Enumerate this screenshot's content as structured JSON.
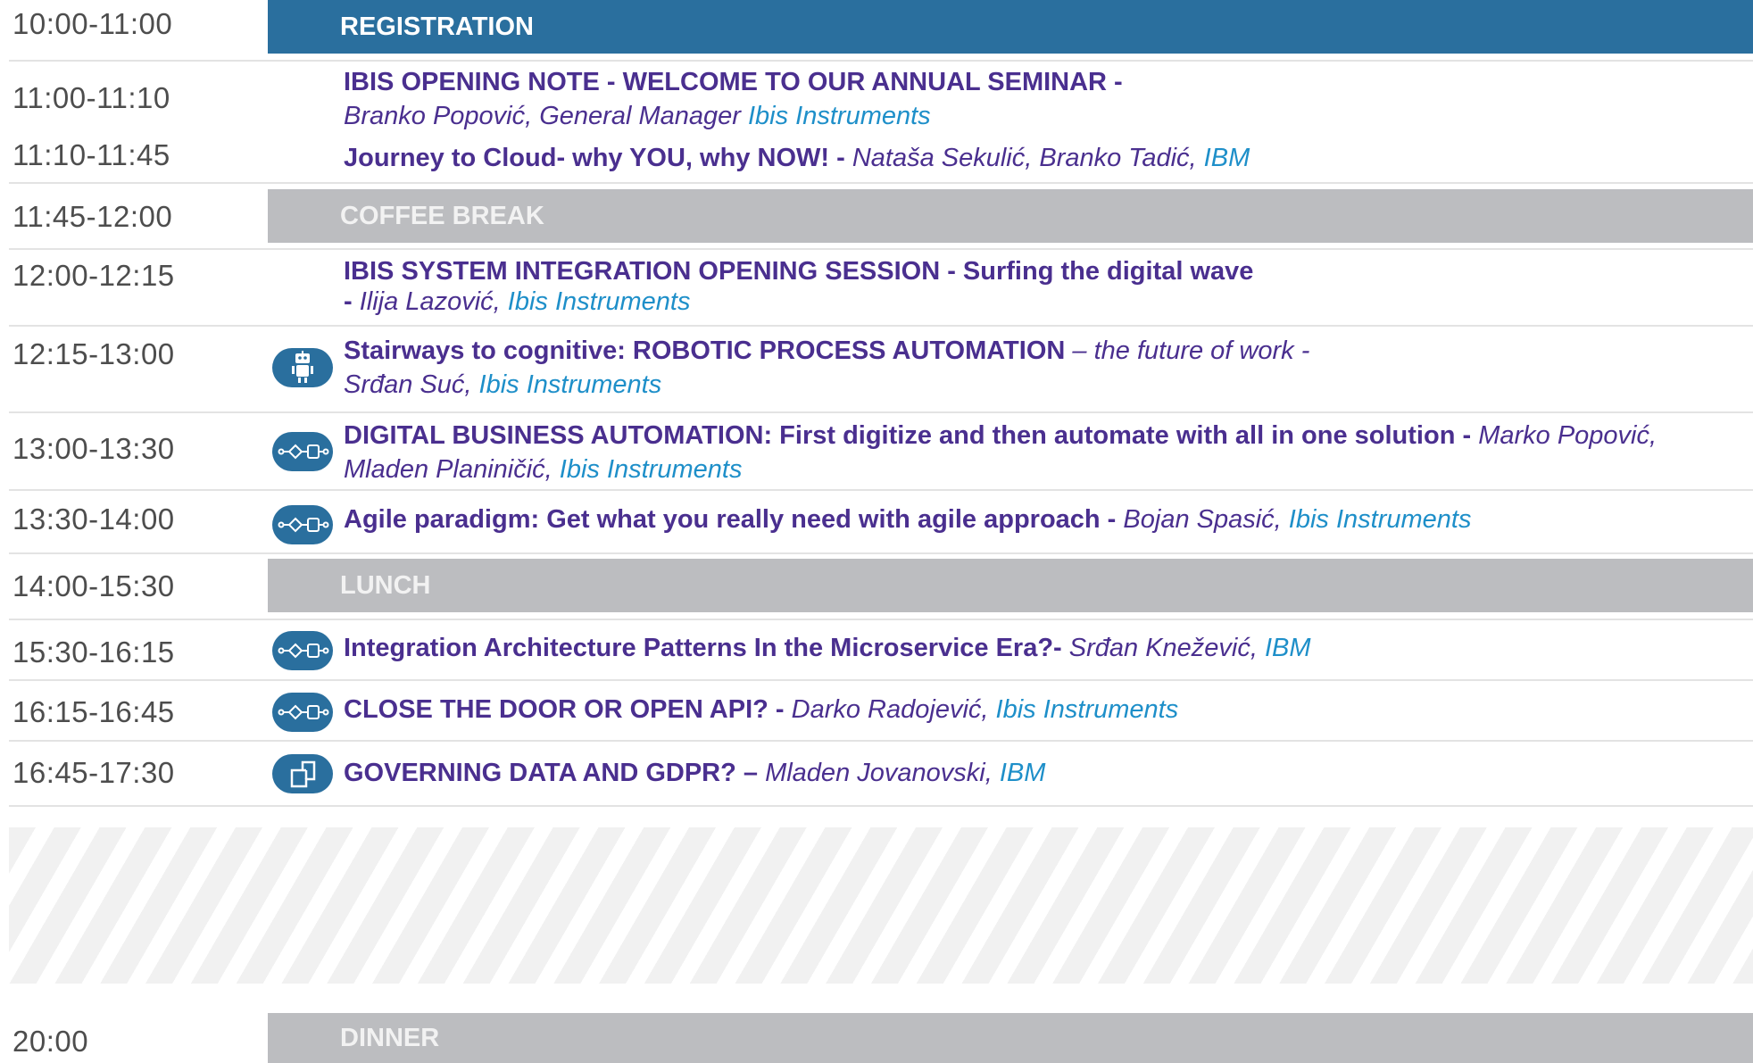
{
  "schedule": [
    {
      "time": "10:00-11:00",
      "kind": "break",
      "label": "REGISTRATION",
      "style": "blue"
    },
    {
      "time": "11:00-11:10",
      "kind": "talk",
      "title": "IBIS OPENING NOTE - WELCOME TO OUR ANNUAL SEMINAR -",
      "person": "Branko Popović, General Manager",
      "org": "Ibis Instruments",
      "icon": ""
    },
    {
      "time": "11:10-11:45",
      "kind": "talk",
      "title": "Journey to Cloud- why YOU, why NOW! -",
      "person": "Nataša Sekulić, Branko Tadić,",
      "org": "IBM",
      "icon": ""
    },
    {
      "time": "11:45-12:00",
      "kind": "break",
      "label": "COFFEE BREAK",
      "style": "grey"
    },
    {
      "time": "12:00-12:15",
      "kind": "talk",
      "title": "IBIS SYSTEM INTEGRATION OPENING SESSION - Surfing the digital wave",
      "title2": "-",
      "person": "Ilija Lazović,",
      "org": "Ibis Instruments",
      "icon": ""
    },
    {
      "time": "12:15-13:00",
      "kind": "talk",
      "title": "Stairways to cognitive: ROBOTIC PROCESS AUTOMATION",
      "subtitle": "– the future of work -",
      "person": "Srđan Suć,",
      "org": "Ibis Instruments",
      "icon": "robot-icon"
    },
    {
      "time": "13:00-13:30",
      "kind": "talk",
      "title": "DIGITAL BUSINESS AUTOMATION: First digitize and then automate with all in one solution -",
      "person_inline": "Marko Popović,",
      "person": "Mladen Planiničić,",
      "org": "Ibis Instruments",
      "icon": "workflow-icon"
    },
    {
      "time": "13:30-14:00",
      "kind": "talk",
      "title": "Agile paradigm: Get what you really need with agile approach -",
      "person": "Bojan Spasić,",
      "org": "Ibis Instruments",
      "icon": "workflow-icon"
    },
    {
      "time": "14:00-15:30",
      "kind": "break",
      "label": "LUNCH",
      "style": "grey"
    },
    {
      "time": "15:30-16:15",
      "kind": "talk",
      "title": "Integration Architecture Patterns In the Microservice Era?-",
      "person": "Srđan Knežević,",
      "org": "IBM",
      "icon": "workflow-icon"
    },
    {
      "time": "16:15-16:45",
      "kind": "talk",
      "title": "CLOSE THE DOOR OR OPEN API? -",
      "person": "Darko Radojević,",
      "org": "Ibis Instruments",
      "icon": "workflow-icon"
    },
    {
      "time": "16:45-17:30",
      "kind": "talk",
      "title": "GOVERNING DATA AND GDPR? –",
      "person": "Mladen Jovanovski,",
      "org": "IBM",
      "icon": "data-icon"
    },
    {
      "time": "20:00",
      "kind": "break",
      "label": "DINNER",
      "style": "grey"
    }
  ],
  "colors": {
    "accent_blue": "#2a6f9e",
    "title_purple": "#4a2f8f",
    "org_blue": "#1e8fc9",
    "break_grey": "#bcbdc0"
  }
}
